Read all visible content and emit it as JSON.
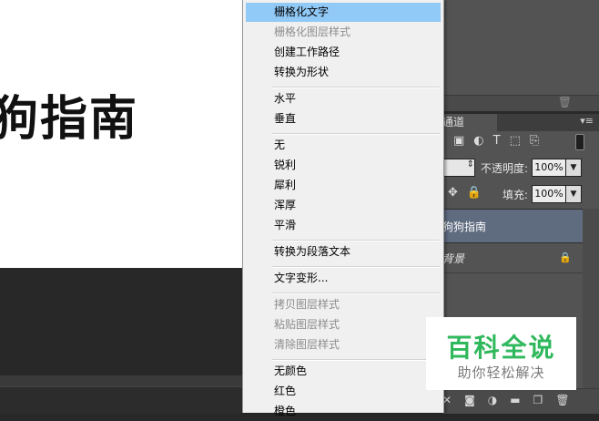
{
  "canvas": {
    "text": "狗指南"
  },
  "context_menu": {
    "items": [
      {
        "label": "栅格化文字",
        "state": "selected"
      },
      {
        "label": "栅格化图层样式",
        "state": "disabled"
      },
      {
        "label": "创建工作路径",
        "state": "enabled"
      },
      {
        "label": "转换为形状",
        "state": "enabled"
      },
      {
        "label": "水平",
        "state": "enabled"
      },
      {
        "label": "垂直",
        "state": "enabled"
      },
      {
        "label": "无",
        "state": "enabled"
      },
      {
        "label": "锐利",
        "state": "enabled"
      },
      {
        "label": "犀利",
        "state": "enabled"
      },
      {
        "label": "浑厚",
        "state": "enabled"
      },
      {
        "label": "平滑",
        "state": "enabled"
      },
      {
        "label": "转换为段落文本",
        "state": "enabled"
      },
      {
        "label": "文字变形...",
        "state": "enabled"
      },
      {
        "label": "拷贝图层样式",
        "state": "disabled"
      },
      {
        "label": "粘贴图层样式",
        "state": "disabled"
      },
      {
        "label": "清除图层样式",
        "state": "disabled"
      },
      {
        "label": "无颜色",
        "state": "enabled"
      },
      {
        "label": "红色",
        "state": "enabled"
      },
      {
        "label": "橙色",
        "state": "enabled"
      }
    ]
  },
  "layers_panel": {
    "tab_label": "通道",
    "opacity_label": "不透明度:",
    "opacity_value": "100%",
    "fill_label": "填充:",
    "fill_value": "100%",
    "layers": [
      {
        "name": "狗狗指南",
        "selected": true
      },
      {
        "name": "背景",
        "locked": true
      }
    ]
  },
  "watermark": {
    "title": "百科全说",
    "subtitle": "助你轻松解决"
  },
  "colors": {
    "menu_highlight": "#91c9f7",
    "watermark_green": "#2fb85c",
    "layer_selected": "#5f6b7f"
  }
}
